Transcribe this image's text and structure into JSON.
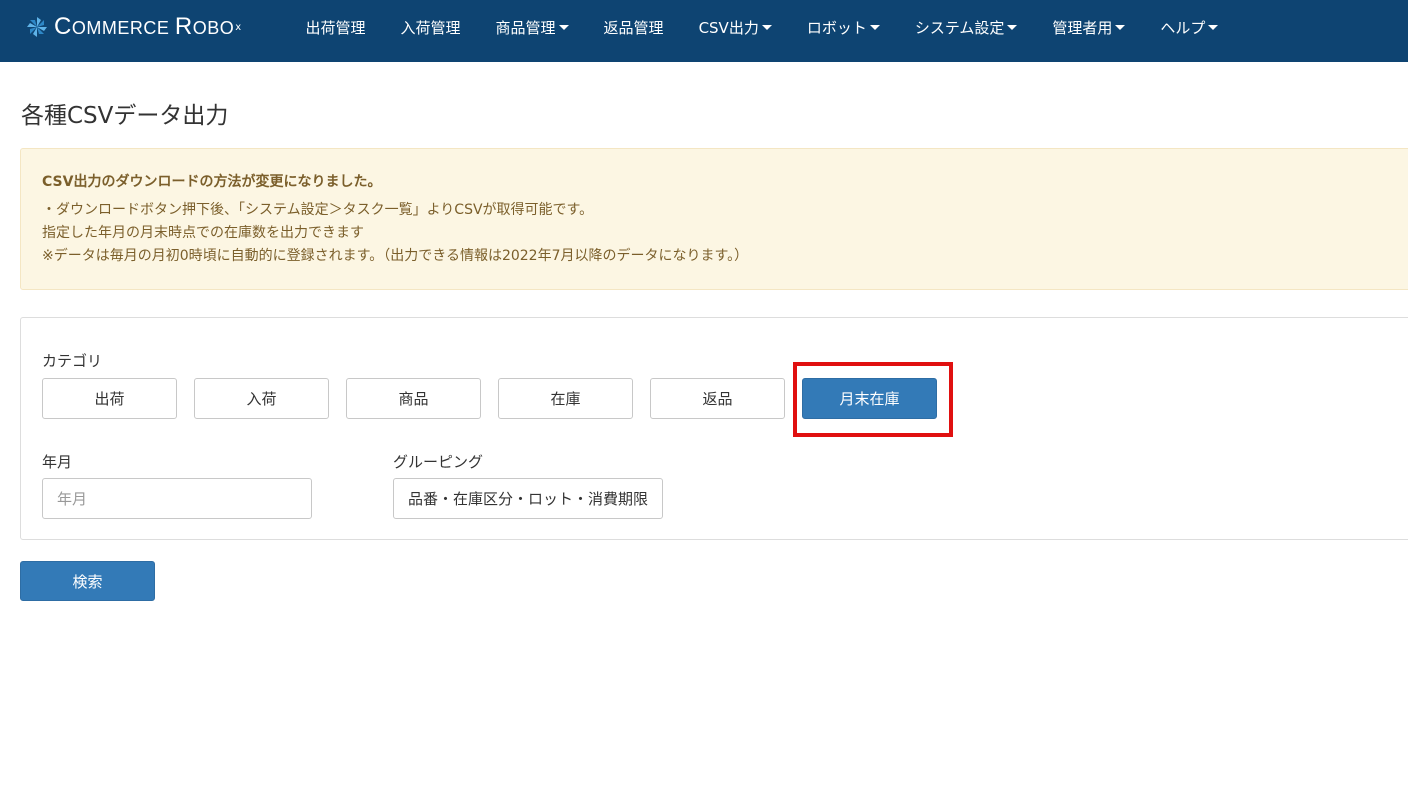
{
  "brand": {
    "name": "Commerce Robo",
    "mark": "pinwheel-logo",
    "superscript": "x"
  },
  "nav": {
    "items": [
      {
        "label": "出荷管理",
        "dropdown": false
      },
      {
        "label": "入荷管理",
        "dropdown": false
      },
      {
        "label": "商品管理",
        "dropdown": true
      },
      {
        "label": "返品管理",
        "dropdown": false
      },
      {
        "label": "CSV出力",
        "dropdown": true
      },
      {
        "label": "ロボット",
        "dropdown": true
      },
      {
        "label": "システム設定",
        "dropdown": true
      },
      {
        "label": "管理者用",
        "dropdown": true
      },
      {
        "label": "ヘルプ",
        "dropdown": true
      }
    ]
  },
  "page": {
    "title": "各種CSVデータ出力"
  },
  "notice": {
    "title": "CSV出力のダウンロードの方法が変更になりました。",
    "lines": [
      "・ダウンロードボタン押下後、「システム設定＞タスク一覧」よりCSVが取得可能です。",
      "指定した年月の月末時点での在庫数を出力できます",
      "※データは毎月の月初0時頃に自動的に登録されます。（出力できる情報は2022年7月以降のデータになります。）"
    ]
  },
  "form": {
    "category_label": "カテゴリ",
    "categories": [
      {
        "label": "出荷",
        "active": false
      },
      {
        "label": "入荷",
        "active": false
      },
      {
        "label": "商品",
        "active": false
      },
      {
        "label": "在庫",
        "active": false
      },
      {
        "label": "返品",
        "active": false
      },
      {
        "label": "月末在庫",
        "active": true
      }
    ],
    "year_month_label": "年月",
    "year_month_placeholder": "年月",
    "year_month_value": "",
    "grouping_label": "グルーピング",
    "grouping_value": "品番・在庫区分・ロット・消費期限"
  },
  "search": {
    "label": "検索"
  },
  "colors": {
    "navbar": "#0e4472",
    "primary": "#337ab7",
    "alert_bg": "#fcf6e3",
    "alert_text": "#7b5f2b",
    "highlight": "#e01010"
  }
}
